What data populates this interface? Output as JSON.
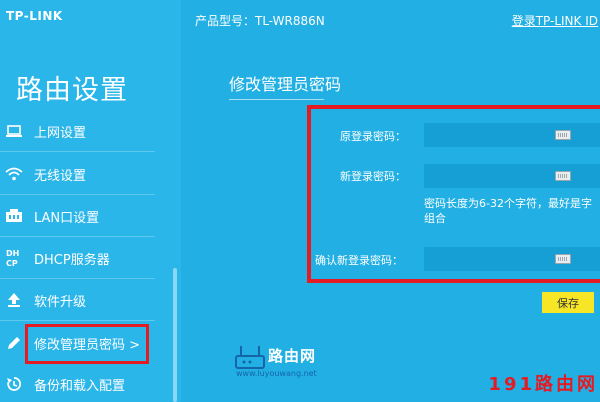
{
  "brand": {
    "logo": "TP-LINK"
  },
  "header": {
    "model": "产品型号：TL-WR886N",
    "login_link": "登录TP-LINK ID"
  },
  "sidebar": {
    "title": "路由设置",
    "items": [
      {
        "label": "上网设置",
        "icon": "internet-icon"
      },
      {
        "label": "无线设置",
        "icon": "wifi-icon"
      },
      {
        "label": "LAN口设置",
        "icon": "lan-port-icon"
      },
      {
        "label": "DHCP服务器",
        "icon": "dhcp-icon"
      },
      {
        "label": "软件升级",
        "icon": "upgrade-icon"
      },
      {
        "label": "修改管理员密码 >",
        "icon": "pencil-icon",
        "active": true
      },
      {
        "label": "备份和载入配置",
        "icon": "backup-restore-icon"
      }
    ]
  },
  "main": {
    "section_title": "修改管理员密码",
    "fields": [
      {
        "label": "原登录密码：",
        "value": ""
      },
      {
        "label": "新登录密码：",
        "value": ""
      },
      {
        "label": "确认新登录密码：",
        "value": ""
      }
    ],
    "hint_line1": "密码长度为6-32个字符，最好是字",
    "hint_line2": "组合",
    "save_label": "保存"
  },
  "watermark": {
    "logo_text": "路由网",
    "url": "www.luyouwang.net",
    "corner": "191路由网"
  },
  "colors": {
    "background": "#22b0e4",
    "sidebar": "#2bb6ea",
    "input": "#169fd4",
    "highlight": "#e51b23",
    "save_button": "#f7e626"
  }
}
